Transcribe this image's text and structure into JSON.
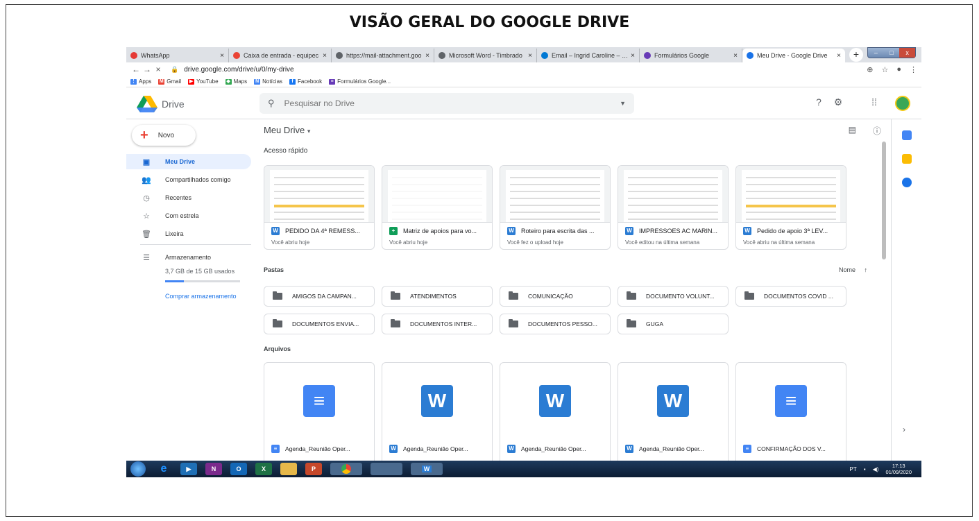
{
  "page_title": "VISÃO GERAL DO GOOGLE DRIVE",
  "browser": {
    "tabs": [
      {
        "label": "WhatsApp",
        "color": "#e53935",
        "active": false
      },
      {
        "label": "Caixa de entrada - equipec",
        "color": "#ea4335",
        "active": false
      },
      {
        "label": "https://mail-attachment.goo",
        "color": "#5f6368",
        "active": false
      },
      {
        "label": "Microsoft Word - Timbrado",
        "color": "#5f6368",
        "active": false
      },
      {
        "label": "Email – Ingrid Caroline – Ou",
        "color": "#0078d4",
        "active": false
      },
      {
        "label": "Formulários Google",
        "color": "#673ab7",
        "active": false
      },
      {
        "label": "Meu Drive - Google Drive",
        "color": "#1a73e8",
        "active": true
      }
    ],
    "tab_close": "×",
    "new_tab": "+",
    "window_controls": {
      "minimize": "–",
      "maximize": "□",
      "close": "x"
    },
    "back": "←",
    "forward": "→",
    "stop": "×",
    "url": "drive.google.com/drive/u/0/my-drive",
    "bookmarks": [
      {
        "label": "Apps",
        "color": "#4285f4",
        "glyph": "⋮"
      },
      {
        "label": "Gmail",
        "color": "#ea4335",
        "glyph": "M"
      },
      {
        "label": "YouTube",
        "color": "#ff0000",
        "glyph": "▶"
      },
      {
        "label": "Maps",
        "color": "#34a853",
        "glyph": "◆"
      },
      {
        "label": "Notícias",
        "color": "#4285f4",
        "glyph": "N"
      },
      {
        "label": "Facebook",
        "color": "#1877f2",
        "glyph": "f"
      },
      {
        "label": "Formulários Google...",
        "color": "#673ab7",
        "glyph": "≡"
      }
    ]
  },
  "drive": {
    "app_name": "Drive",
    "search_placeholder": "Pesquisar no Drive",
    "new_label": "Novo",
    "sidebar": [
      {
        "label": "Meu Drive",
        "icon": "▣",
        "active": true
      },
      {
        "label": "Compartilhados comigo",
        "icon": "👥",
        "active": false
      },
      {
        "label": "Recentes",
        "icon": "◷",
        "active": false
      },
      {
        "label": "Com estrela",
        "icon": "☆",
        "active": false
      },
      {
        "label": "Lixeira",
        "icon": "🗑",
        "active": false
      }
    ],
    "storage": {
      "label": "Armazenamento",
      "usage": "3,7 GB de 15 GB usados",
      "used_fraction": 0.25,
      "buy_label": "Comprar armazenamento"
    },
    "breadcrumb": "Meu Drive",
    "quick_access_label": "Acesso rápido",
    "quick_access": [
      {
        "name": "PEDIDO DA 4ª REMESS...",
        "type": "W",
        "color": "#2b7cd3",
        "subtitle": "Você abriu hoje"
      },
      {
        "name": "Matriz de apoios para vo...",
        "type": "+",
        "color": "#0f9d58",
        "subtitle": "Você abriu hoje"
      },
      {
        "name": "Roteiro para escrita das ...",
        "type": "W",
        "color": "#2b7cd3",
        "subtitle": "Você fez o upload hoje"
      },
      {
        "name": "IMPRESSOES AC MARIN...",
        "type": "W",
        "color": "#2b7cd3",
        "subtitle": "Você editou na última semana"
      },
      {
        "name": "Pedido de apoio 3ª LEV...",
        "type": "W",
        "color": "#2b7cd3",
        "subtitle": "Você abriu na última semana"
      }
    ],
    "folders_label": "Pastas",
    "sort_label": "Nome",
    "sort_arrow": "↑",
    "folders": [
      "AMIGOS DA CAMPAN...",
      "ATENDIMENTOS",
      "COMUNICAÇÃO",
      "DOCUMENTO VOLUNT...",
      "DOCUMENTOS COVID ...",
      "DOCUMENTOS ENVIA...",
      "DOCUMENTOS INTER...",
      "DOCUMENTOS PESSO...",
      "GUGA"
    ],
    "files_label": "Arquivos",
    "files": [
      {
        "name": "Agenda_Reunião Oper...",
        "kind": "doc",
        "type": "≡",
        "color": "#4285f4"
      },
      {
        "name": "Agenda_Reunião Oper...",
        "kind": "word",
        "type": "W",
        "color": "#2b7cd3"
      },
      {
        "name": "Agenda_Reunião Oper...",
        "kind": "word",
        "type": "W",
        "color": "#2b7cd3"
      },
      {
        "name": "Agenda_Reunião Oper...",
        "kind": "word",
        "type": "W",
        "color": "#2b7cd3"
      },
      {
        "name": "CONFIRMAÇÃO DOS V...",
        "kind": "doc",
        "type": "≡",
        "color": "#4285f4"
      }
    ]
  },
  "taskbar": {
    "lang": "PT",
    "time": "17:13",
    "date": "01/09/2020"
  }
}
